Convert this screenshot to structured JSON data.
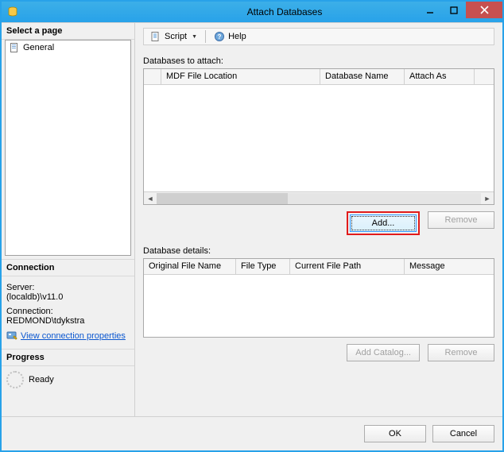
{
  "window": {
    "title": "Attach Databases"
  },
  "left": {
    "selectPageHeader": "Select a page",
    "generalItem": "General",
    "connectionHeader": "Connection",
    "serverLabel": "Server:",
    "serverValue": "(localdb)\\v11.0",
    "connectionLabel": "Connection:",
    "connectionValue": "REDMOND\\tdykstra",
    "viewConnLink": "View connection properties",
    "progressHeader": "Progress",
    "progressStatus": "Ready"
  },
  "toolbar": {
    "script": "Script",
    "help": "Help"
  },
  "attach": {
    "label": "Databases to attach:",
    "cols": {
      "mdf": "MDF File Location",
      "db": "Database Name",
      "as": "Attach As"
    },
    "add": "Add...",
    "remove": "Remove"
  },
  "details": {
    "label": "Database details:",
    "cols": {
      "orig": "Original File Name",
      "type": "File Type",
      "path": "Current File Path",
      "msg": "Message"
    },
    "addCatalog": "Add Catalog...",
    "remove": "Remove"
  },
  "dialog": {
    "ok": "OK",
    "cancel": "Cancel"
  }
}
